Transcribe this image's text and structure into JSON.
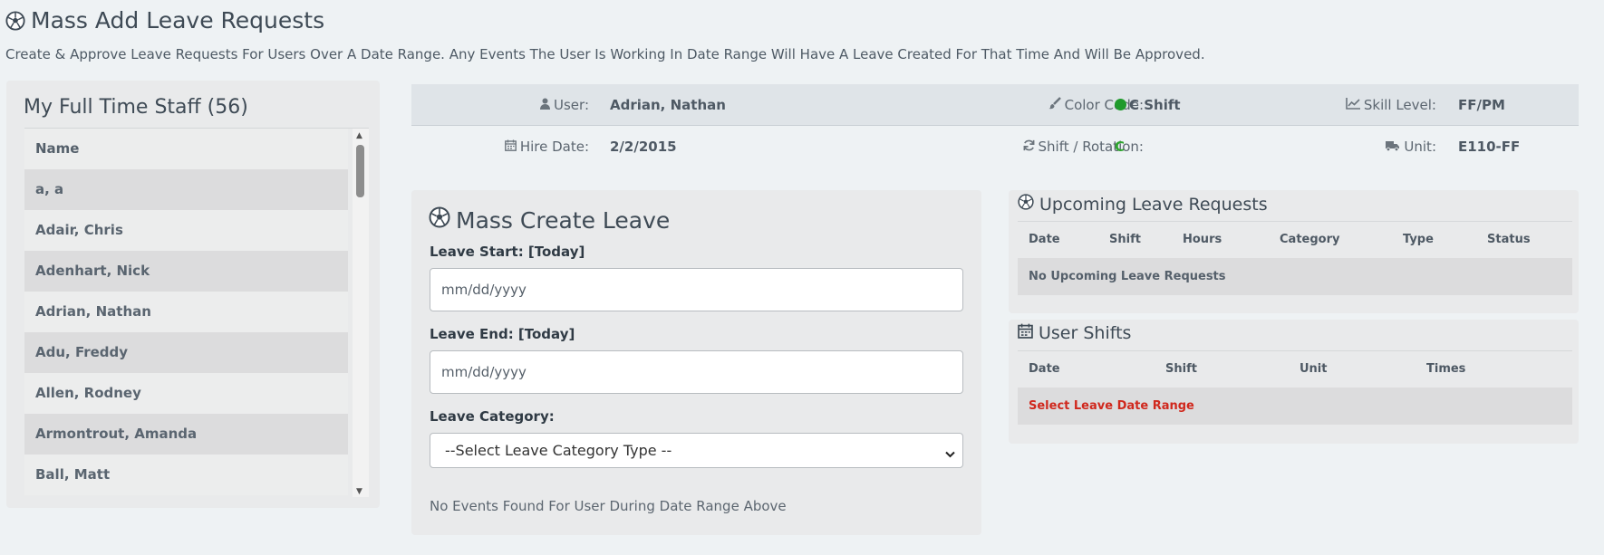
{
  "page": {
    "title": "Mass Add Leave Requests",
    "subtitle": "Create & Approve Leave Requests For Users Over A Date Range. Any Events The User Is Working In Date Range Will Have A Leave Created For That Time And Will Be Approved."
  },
  "staff": {
    "title": "My Full Time Staff (56)",
    "column": "Name",
    "rows": [
      "a, a",
      "Adair, Chris",
      "Adenhart, Nick",
      "Adrian, Nathan",
      "Adu, Freddy",
      "Allen, Rodney",
      "Armontrout, Amanda",
      "Ball, Matt"
    ]
  },
  "user_info": {
    "user_label": "User:",
    "user_value": "Adrian, Nathan",
    "color_label": "Color Code:",
    "color_value": "C Shift",
    "color_dot": "#1f9a2c",
    "skill_label": "Skill Level:",
    "skill_value": "FF/PM",
    "hire_label": "Hire Date:",
    "hire_value": "2/2/2015",
    "shift_label": "Shift / Rotation:",
    "shift_value": "C",
    "unit_label": "Unit:",
    "unit_value": "E110-FF"
  },
  "create": {
    "title": "Mass Create Leave",
    "start_label": "Leave Start: [Today]",
    "start_placeholder": "mm/dd/yyyy",
    "end_label": "Leave End: [Today]",
    "end_placeholder": "mm/dd/yyyy",
    "category_label": "Leave Category:",
    "category_selected": "--Select Leave Category Type --",
    "no_events": "No Events Found For User During Date Range Above"
  },
  "upcoming": {
    "title": "Upcoming Leave Requests",
    "columns": [
      "Date",
      "Shift",
      "Hours",
      "Category",
      "Type",
      "Status"
    ],
    "empty": "No Upcoming Leave Requests"
  },
  "shifts": {
    "title": "User Shifts",
    "columns": [
      "Date",
      "Shift",
      "Unit",
      "Times"
    ],
    "empty": "Select Leave Date Range"
  },
  "colors": {
    "background": "#eef2f4",
    "accent_green": "#2fa52f",
    "alert_red": "#d0281d"
  },
  "icons": [
    "soccer-ball-icon",
    "user-icon",
    "paintbrush-icon",
    "line-chart-icon",
    "calendar-icon",
    "refresh-icon",
    "truck-icon",
    "chevron-down-icon"
  ]
}
